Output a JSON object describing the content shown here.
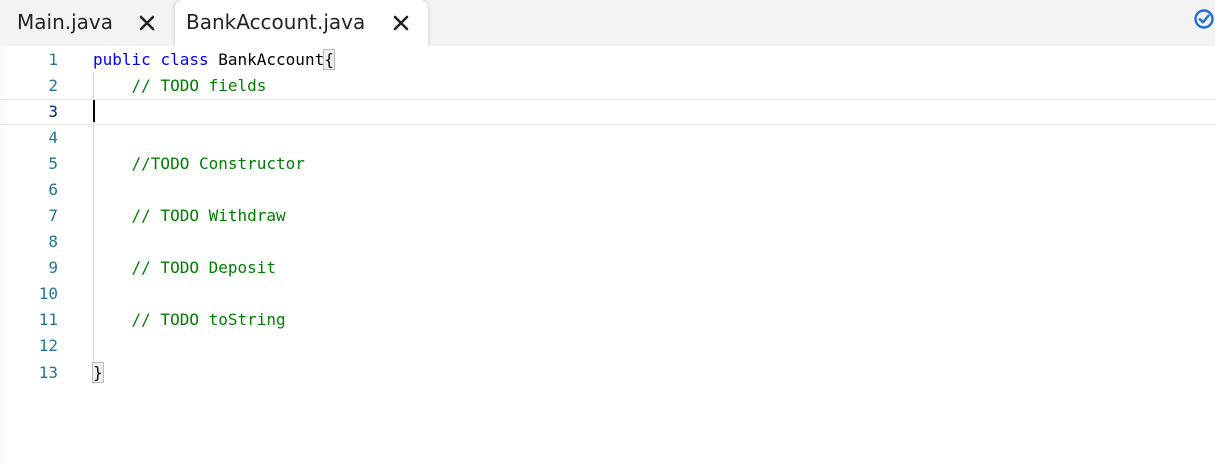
{
  "tabs": [
    {
      "label": "Main.java",
      "active": false
    },
    {
      "label": "BankAccount.java",
      "active": true
    }
  ],
  "status_icon": "check-circle-icon",
  "colors": {
    "keyword": "#0000ff",
    "comment": "#008000",
    "line_number": "#237893",
    "active_line_number": "#0b216f",
    "status_accent": "#1f6fd1"
  },
  "editor": {
    "cursor_line": 3,
    "lines": [
      {
        "num": "1",
        "kw1": "public",
        "kw2": "class",
        "text": " BankAccount",
        "bracket": "{"
      },
      {
        "num": "2",
        "comment": "// TODO fields"
      },
      {
        "num": "3"
      },
      {
        "num": "4"
      },
      {
        "num": "5",
        "comment": "//TODO Constructor"
      },
      {
        "num": "6"
      },
      {
        "num": "7",
        "comment": "// TODO Withdraw"
      },
      {
        "num": "8"
      },
      {
        "num": "9",
        "comment": "// TODO Deposit"
      },
      {
        "num": "10"
      },
      {
        "num": "11",
        "comment": "// TODO toString"
      },
      {
        "num": "12"
      },
      {
        "num": "13",
        "bracket": "}"
      }
    ]
  }
}
